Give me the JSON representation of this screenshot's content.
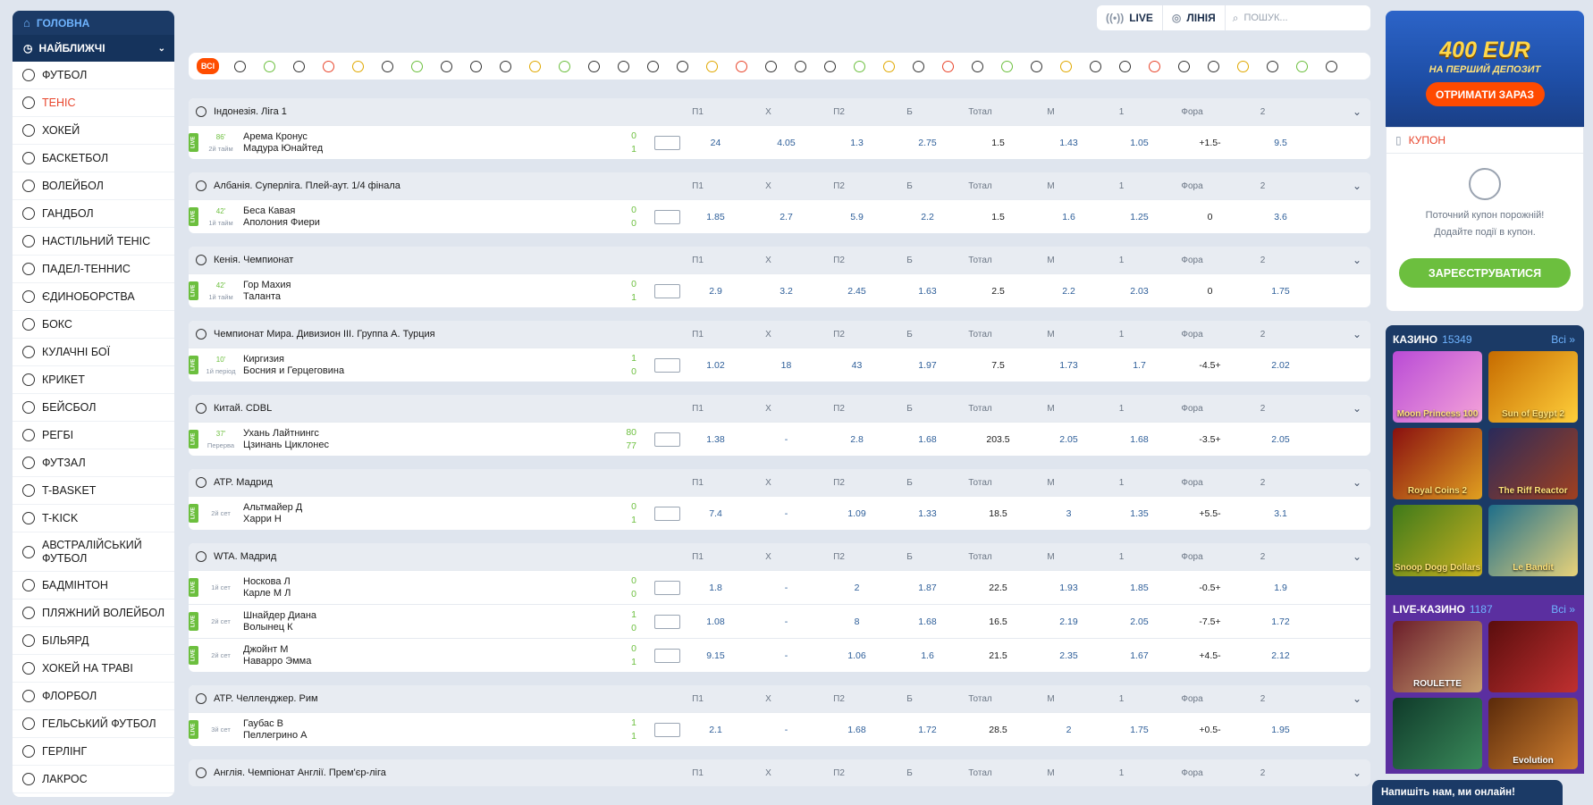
{
  "sidebar": {
    "home": "ГОЛОВНА",
    "nearest": "НАЙБЛИЖЧІ",
    "items": [
      {
        "label": "ФУТБОЛ",
        "icon": "football-icon"
      },
      {
        "label": "ТЕНІС",
        "icon": "tennis-icon",
        "active": true
      },
      {
        "label": "ХОКЕЙ",
        "icon": "hockey-icon"
      },
      {
        "label": "БАСКЕТБОЛ",
        "icon": "basketball-icon"
      },
      {
        "label": "ВОЛЕЙБОЛ",
        "icon": "volleyball-icon"
      },
      {
        "label": "ГАНДБОЛ",
        "icon": "handball-icon"
      },
      {
        "label": "НАСТІЛЬНИЙ ТЕНІС",
        "icon": "table-tennis-icon"
      },
      {
        "label": "ПАДЕЛ-ТЕННИС",
        "icon": "padel-icon"
      },
      {
        "label": "ЄДИНОБОРСТВА",
        "icon": "martial-arts-icon"
      },
      {
        "label": "БОКС",
        "icon": "boxing-icon"
      },
      {
        "label": "КУЛАЧНІ БОЇ",
        "icon": "fist-fight-icon"
      },
      {
        "label": "КРИКЕТ",
        "icon": "cricket-icon"
      },
      {
        "label": "БЕЙСБОЛ",
        "icon": "baseball-icon"
      },
      {
        "label": "РЕГБІ",
        "icon": "rugby-icon"
      },
      {
        "label": "ФУТЗАЛ",
        "icon": "futsal-icon"
      },
      {
        "label": "T-BASKET",
        "icon": "t-basket-icon"
      },
      {
        "label": "T-KICK",
        "icon": "t-kick-icon"
      },
      {
        "label": "АВСТРАЛІЙСЬКИЙ ФУТБОЛ",
        "icon": "aussie-football-icon",
        "two": true
      },
      {
        "label": "БАДМІНТОН",
        "icon": "badminton-icon"
      },
      {
        "label": "ПЛЯЖНИЙ ВОЛЕЙБОЛ",
        "icon": "beach-volleyball-icon"
      },
      {
        "label": "БІЛЬЯРД",
        "icon": "billiard-icon"
      },
      {
        "label": "ХОКЕЙ НА ТРАВІ",
        "icon": "field-hockey-icon"
      },
      {
        "label": "ФЛОРБОЛ",
        "icon": "floorball-icon"
      },
      {
        "label": "ГЕЛЬСЬКИЙ ФУТБОЛ",
        "icon": "gaelic-football-icon"
      },
      {
        "label": "ГЕРЛІНГ",
        "icon": "hurling-icon"
      },
      {
        "label": "ЛАКРОС",
        "icon": "lacrosse-icon"
      }
    ]
  },
  "topbar": {
    "live": "LIVE",
    "line": "ЛІНІЯ",
    "search_placeholder": "ПОШУК..."
  },
  "sportsbar": {
    "all": "ВСІ",
    "count": 38
  },
  "columns": [
    "П1",
    "X",
    "П2",
    "Б",
    "Тотал",
    "М",
    "1",
    "Фора",
    "2"
  ],
  "leagues": [
    {
      "name": "Індонезія. Ліга 1",
      "icon": "football-icon",
      "events": [
        {
          "min": "86'",
          "period": "2й тайм",
          "home": "Арема Кронус",
          "away": "Мадура Юнайтед",
          "s1": "0",
          "s2": "1",
          "odds": [
            "24",
            "4.05",
            "1.3",
            "2.75",
            "1.5",
            "1.43",
            "1.05",
            "+1.5-",
            "9.5"
          ]
        }
      ]
    },
    {
      "name": "Албанія. Суперліга. Плей-аут. 1/4 фінала",
      "icon": "football-icon",
      "events": [
        {
          "min": "42'",
          "period": "1й тайм",
          "home": "Беса Кавая",
          "away": "Аполония Фиери",
          "s1": "0",
          "s2": "0",
          "odds": [
            "1.85",
            "2.7",
            "5.9",
            "2.2",
            "1.5",
            "1.6",
            "1.25",
            "0",
            "3.6"
          ]
        }
      ]
    },
    {
      "name": "Кенія. Чемпионат",
      "icon": "football-icon",
      "events": [
        {
          "min": "42'",
          "period": "1й тайм",
          "home": "Гор Махия",
          "away": "Таланта",
          "s1": "0",
          "s2": "1",
          "odds": [
            "2.9",
            "3.2",
            "2.45",
            "1.63",
            "2.5",
            "2.2",
            "2.03",
            "0",
            "1.75"
          ]
        }
      ]
    },
    {
      "name": "Чемпионат Мира. Дивизион III. Группа А. Турция",
      "icon": "hockey-icon",
      "events": [
        {
          "min": "10'",
          "period": "1й період",
          "home": "Киргизия",
          "away": "Босния и Герцеговина",
          "s1": "1",
          "s2": "0",
          "odds": [
            "1.02",
            "18",
            "43",
            "1.97",
            "7.5",
            "1.73",
            "1.7",
            "-4.5+",
            "2.02"
          ]
        }
      ]
    },
    {
      "name": "Китай. CDBL",
      "icon": "basketball-icon",
      "events": [
        {
          "min": "37'",
          "period": "Перерва",
          "home": "Ухань Лайтнингс",
          "away": "Цзинань Циклонес",
          "s1": "80",
          "s2": "77",
          "odds": [
            "1.38",
            "-",
            "2.8",
            "1.68",
            "203.5",
            "2.05",
            "1.68",
            "-3.5+",
            "2.05"
          ]
        }
      ]
    },
    {
      "name": "ATP. Мадрид",
      "icon": "tennis-icon",
      "events": [
        {
          "min": "",
          "period": "2й сет",
          "home": "Альтмайер Д",
          "away": "Харри Н",
          "s1": "0",
          "s2": "1",
          "odds": [
            "7.4",
            "-",
            "1.09",
            "1.33",
            "18.5",
            "3",
            "1.35",
            "+5.5-",
            "3.1"
          ]
        }
      ]
    },
    {
      "name": "WTA. Мадрид",
      "icon": "tennis-icon",
      "events": [
        {
          "min": "",
          "period": "1й сет",
          "home": "Носкова Л",
          "away": "Карле М Л",
          "s1": "0",
          "s2": "0",
          "odds": [
            "1.8",
            "-",
            "2",
            "1.87",
            "22.5",
            "1.93",
            "1.85",
            "-0.5+",
            "1.9"
          ]
        },
        {
          "min": "",
          "period": "2й сет",
          "home": "Шнайдер Диана",
          "away": "Волынец К",
          "s1": "1",
          "s2": "0",
          "odds": [
            "1.08",
            "-",
            "8",
            "1.68",
            "16.5",
            "2.19",
            "2.05",
            "-7.5+",
            "1.72"
          ]
        },
        {
          "min": "",
          "period": "2й сет",
          "home": "Джойнт М",
          "away": "Наварро Эмма",
          "s1": "0",
          "s2": "1",
          "odds": [
            "9.15",
            "-",
            "1.06",
            "1.6",
            "21.5",
            "2.35",
            "1.67",
            "+4.5-",
            "2.12"
          ]
        }
      ]
    },
    {
      "name": "ATP. Челленджер. Рим",
      "icon": "tennis-icon",
      "events": [
        {
          "min": "",
          "period": "3й сет",
          "home": "Гаубас В",
          "away": "Пеллегрино А",
          "s1": "1",
          "s2": "1",
          "odds": [
            "2.1",
            "-",
            "1.68",
            "1.72",
            "28.5",
            "2",
            "1.75",
            "+0.5-",
            "1.95"
          ]
        }
      ]
    },
    {
      "name": "Англія. Чемпіонат Англії. Прем'єр-ліга",
      "icon": "football-icon",
      "events": []
    }
  ],
  "live_label": "LIVE",
  "promo": {
    "amount": "400 EUR",
    "subtitle": "НА ПЕРШИЙ ДЕПОЗИТ",
    "button": "ОТРИМАТИ ЗАРАЗ"
  },
  "coupon": {
    "title": "КУПОН",
    "empty1": "Поточний купон порожній!",
    "empty2": "Додайте події в купон.",
    "register": "ЗАРЕЄСТРУВАТИСЯ"
  },
  "casino": {
    "title": "КАЗИНО",
    "count": "15349",
    "all": "Всі",
    "games": [
      "Moon Princess 100",
      "Sun of Egypt 2",
      "Royal Coins 2",
      "The Riff Reactor",
      "Snoop Dogg Dollars",
      "Le Bandit"
    ]
  },
  "live_casino": {
    "title": "LIVE-КАЗИНО",
    "count": "1187",
    "all": "Всі",
    "games": [
      "ROULETTE",
      "",
      "",
      "Evolution"
    ]
  },
  "chat": "Напишіть нам, ми онлайн!",
  "colors": {
    "accent": "#ff4d00",
    "live": "#6cbf3e",
    "navy": "#1b3a66",
    "odds": "#2d5e99"
  }
}
